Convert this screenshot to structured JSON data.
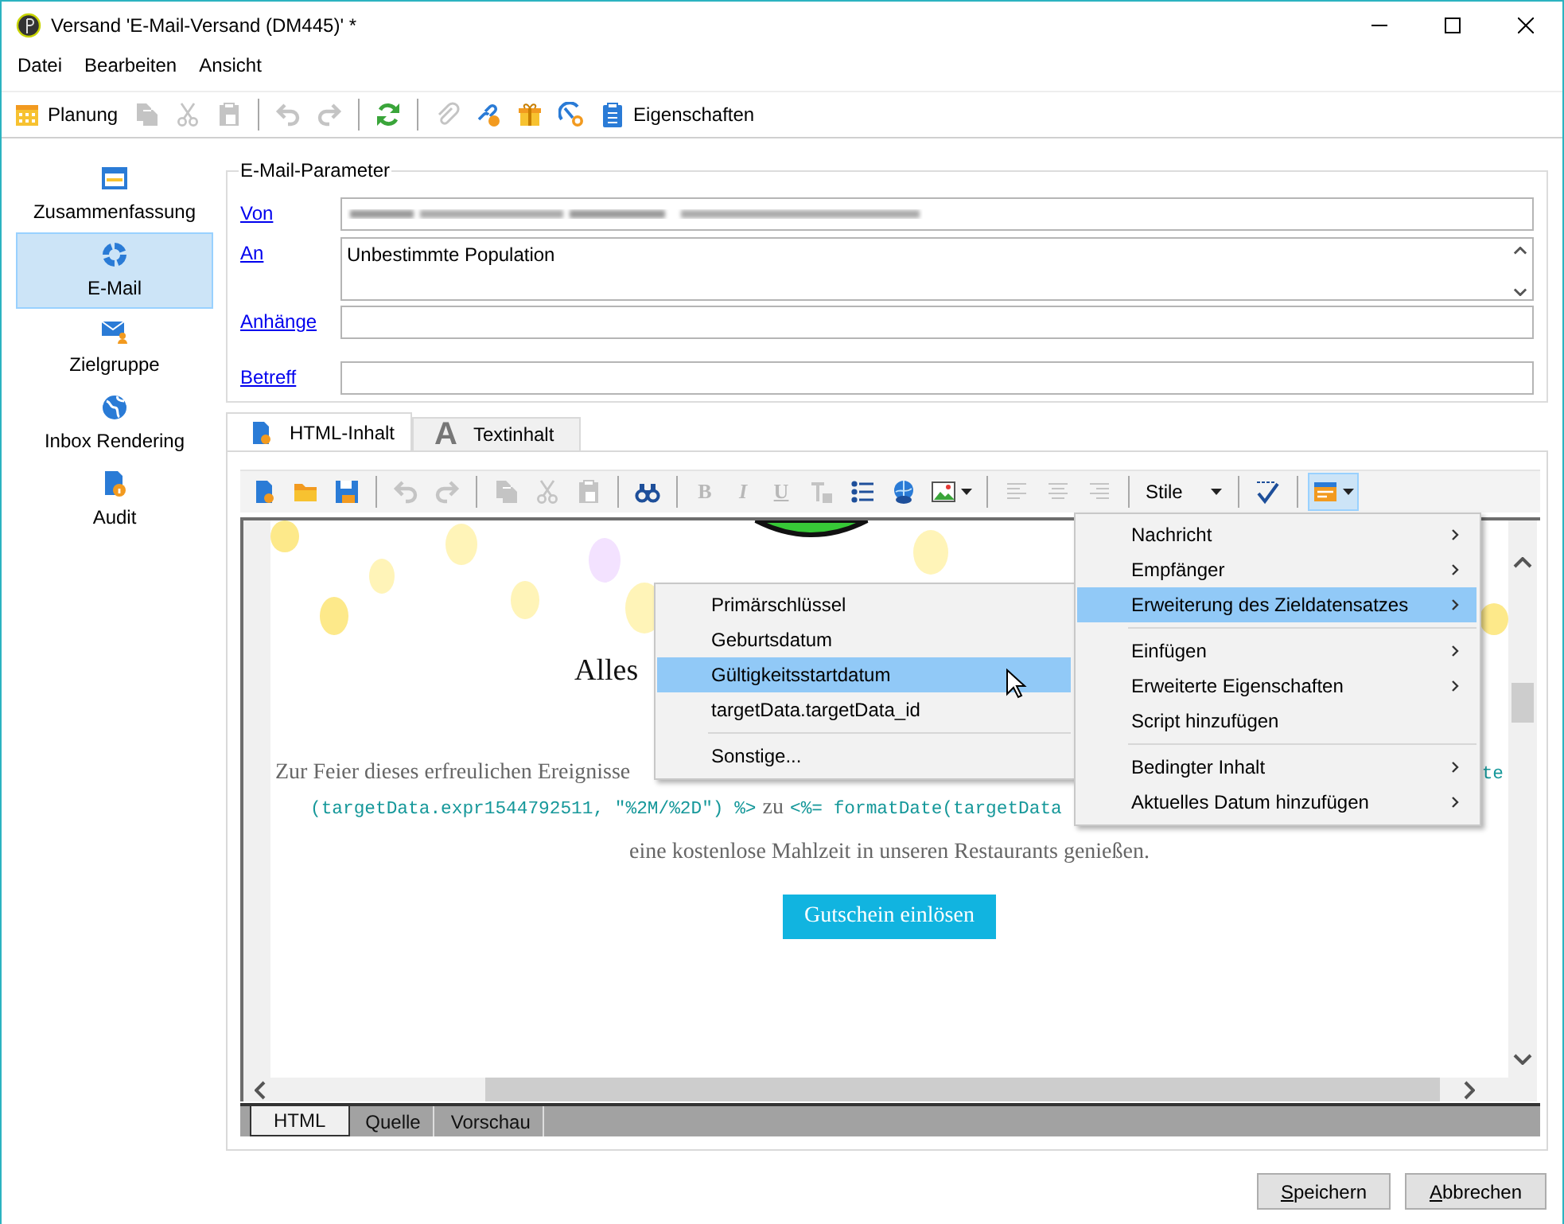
{
  "window": {
    "title": "Versand 'E-Mail-Versand (DM445)' *"
  },
  "menu_bar": [
    {
      "label": "Datei"
    },
    {
      "label": "Bearbeiten"
    },
    {
      "label": "Ansicht"
    }
  ],
  "toolbar": [
    {
      "kind": "button",
      "label": "Planung",
      "disabled": false
    },
    {
      "kind": "button",
      "disabled": true
    },
    {
      "kind": "button",
      "disabled": true
    },
    {
      "kind": "button",
      "disabled": true
    },
    {
      "kind": "separator"
    },
    {
      "kind": "button",
      "disabled": true
    },
    {
      "kind": "button",
      "disabled": true
    },
    {
      "kind": "separator"
    },
    {
      "kind": "button",
      "disabled": false
    },
    {
      "kind": "separator"
    },
    {
      "kind": "button",
      "disabled": true
    },
    {
      "kind": "button",
      "disabled": false
    },
    {
      "kind": "button",
      "disabled": false
    },
    {
      "kind": "button",
      "disabled": false
    },
    {
      "kind": "button",
      "label": "Eigenschaften",
      "disabled": false
    }
  ],
  "sidebar": {
    "items": [
      {
        "label": "Zusammenfassung",
        "selected": false
      },
      {
        "label": "E-Mail",
        "selected": true
      },
      {
        "label": "Zielgruppe",
        "selected": false
      },
      {
        "label": "Inbox Rendering",
        "selected": false
      },
      {
        "label": "Audit",
        "selected": false
      }
    ]
  },
  "email_parameters": {
    "legend": "E-Mail-Parameter",
    "fields": [
      {
        "label": "Von",
        "kind": "redacted"
      },
      {
        "label": "An",
        "kind": "multiline",
        "value": "Unbestimmte Population"
      },
      {
        "label": "Anhänge",
        "kind": "single"
      },
      {
        "label": "Betreff",
        "kind": "single"
      }
    ]
  },
  "content_tabs": [
    {
      "label": "HTML-Inhalt",
      "selected": true
    },
    {
      "label": "Textinhalt",
      "glyph": "A",
      "selected": false
    }
  ],
  "editor_toolbar": [
    {
      "kind": "button",
      "disabled": false
    },
    {
      "kind": "button",
      "disabled": false
    },
    {
      "kind": "button",
      "disabled": false
    },
    {
      "kind": "separator"
    },
    {
      "kind": "button",
      "disabled": true
    },
    {
      "kind": "button",
      "disabled": true
    },
    {
      "kind": "separator"
    },
    {
      "kind": "button",
      "disabled": true
    },
    {
      "kind": "button",
      "disabled": true
    },
    {
      "kind": "button",
      "disabled": true
    },
    {
      "kind": "separator"
    },
    {
      "kind": "button",
      "disabled": false
    },
    {
      "kind": "separator"
    },
    {
      "kind": "letter",
      "label": "B",
      "disabled": true
    },
    {
      "kind": "letter",
      "label": "I",
      "disabled": true
    },
    {
      "kind": "letter",
      "label": "U",
      "disabled": true
    },
    {
      "kind": "button",
      "disabled": true
    },
    {
      "kind": "button",
      "disabled": false
    },
    {
      "kind": "button",
      "disabled": false
    },
    {
      "kind": "dropdown-button",
      "disabled": false,
      "pressed": false
    },
    {
      "kind": "separator"
    },
    {
      "kind": "button",
      "disabled": true
    },
    {
      "kind": "button",
      "disabled": true
    },
    {
      "kind": "button",
      "disabled": true
    },
    {
      "kind": "separator"
    },
    {
      "kind": "combo",
      "label": "Stile"
    },
    {
      "kind": "separator"
    },
    {
      "kind": "button",
      "disabled": false
    },
    {
      "kind": "separator"
    },
    {
      "kind": "dropdown-button",
      "disabled": false,
      "pressed": true
    }
  ],
  "email_preview": {
    "heading": "Alles",
    "lines": [
      {
        "segments": [
          {
            "kind": "text",
            "text": "Zur Feier dieses erfreulichen Ereignisse"
          },
          {
            "kind": "code",
            "text": "te"
          }
        ]
      },
      {
        "segments": [
          {
            "kind": "code",
            "text": "(targetData.expr1544792511, \"%2M/%2D\") %>"
          },
          {
            "kind": "text",
            "text": "zu"
          },
          {
            "kind": "code",
            "text": "<%= formatDate(targetData"
          }
        ]
      },
      {
        "segments": [
          {
            "kind": "text",
            "text": "eine kostenlose Mahlzeit in unseren Restaurants genießen."
          }
        ]
      }
    ],
    "button": "Gutschein einlösen"
  },
  "view_tabs": [
    {
      "label": "HTML",
      "selected": true
    },
    {
      "label": "Quelle",
      "selected": false
    },
    {
      "label": "Vorschau",
      "selected": false
    }
  ],
  "context_menu": {
    "items": [
      {
        "kind": "item",
        "label": "Nachricht",
        "has_submenu": true,
        "selected": false
      },
      {
        "kind": "item",
        "label": "Empfänger",
        "has_submenu": true,
        "selected": false
      },
      {
        "kind": "item",
        "label": "Erweiterung des Zieldatensatzes",
        "has_submenu": true,
        "selected": true
      },
      {
        "kind": "separator"
      },
      {
        "kind": "item",
        "label": "Einfügen",
        "has_submenu": true,
        "selected": false
      },
      {
        "kind": "item",
        "label": "Erweiterte Eigenschaften",
        "has_submenu": true,
        "selected": false
      },
      {
        "kind": "item",
        "label": "Script hinzufügen",
        "has_submenu": false,
        "selected": false
      },
      {
        "kind": "separator"
      },
      {
        "kind": "item",
        "label": "Bedingter Inhalt",
        "has_submenu": true,
        "selected": false
      },
      {
        "kind": "item",
        "label": "Aktuelles Datum hinzufügen",
        "has_submenu": true,
        "selected": false
      }
    ]
  },
  "submenu": {
    "items": [
      {
        "kind": "item",
        "label": "Primärschlüssel",
        "has_submenu": false,
        "selected": false
      },
      {
        "kind": "item",
        "label": "Geburtsdatum",
        "has_submenu": false,
        "selected": false
      },
      {
        "kind": "item",
        "label": "Gültigkeitsstartdatum",
        "has_submenu": false,
        "selected": true
      },
      {
        "kind": "item",
        "label": "targetData.targetData_id",
        "has_submenu": false,
        "selected": false
      },
      {
        "kind": "separator"
      },
      {
        "kind": "item",
        "label": "Sonstige...",
        "has_submenu": false,
        "selected": false
      }
    ]
  },
  "buttons": [
    {
      "label": "Speichern",
      "underline_first": true
    },
    {
      "label": "Abbrechen",
      "underline_first": true
    }
  ]
}
